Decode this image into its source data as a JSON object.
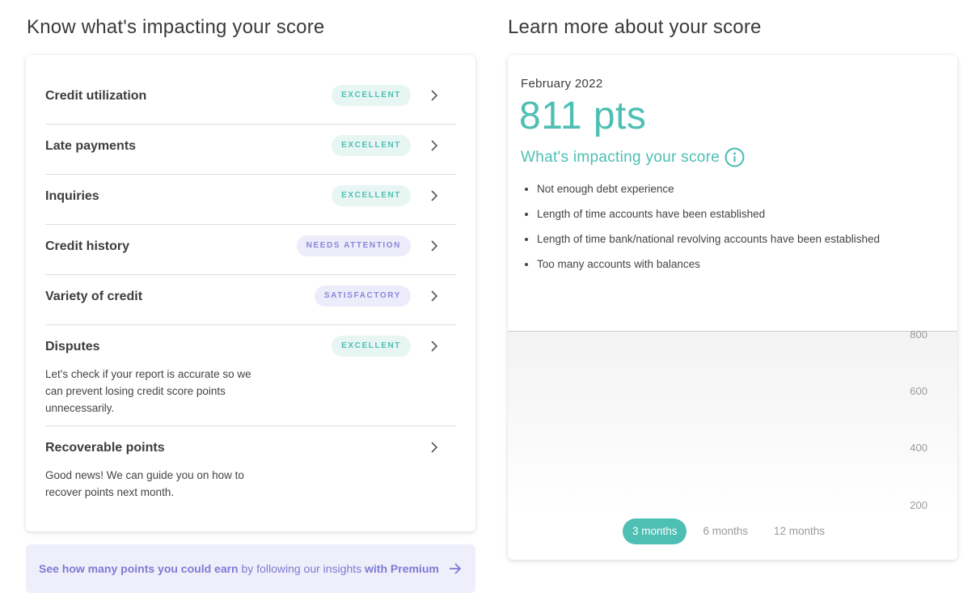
{
  "left": {
    "title": "Know what's impacting your score",
    "factors": [
      {
        "name": "Credit utilization",
        "status": "EXCELLENT",
        "status_kind": "excellent"
      },
      {
        "name": "Late payments",
        "status": "EXCELLENT",
        "status_kind": "excellent"
      },
      {
        "name": "Inquiries",
        "status": "EXCELLENT",
        "status_kind": "excellent"
      },
      {
        "name": "Credit history",
        "status": "NEEDS ATTENTION",
        "status_kind": "attention"
      },
      {
        "name": "Variety of credit",
        "status": "SATISFACTORY",
        "status_kind": "satisfactory"
      },
      {
        "name": "Disputes",
        "status": "EXCELLENT",
        "status_kind": "excellent",
        "description": "Let's check if your report is accurate so we can prevent losing credit score points unnecessarily."
      },
      {
        "name": "Recoverable points",
        "description": "Good news! We can guide you on how to recover points next month."
      }
    ],
    "premium_banner": {
      "bold_start": "See how many points you could earn",
      "middle": " by following our insights ",
      "bold_end": "with Premium"
    }
  },
  "right": {
    "title": "Learn more about your score",
    "date": "February 2022",
    "score": "811 pts",
    "impact_title": "What's impacting your score",
    "impact_items": [
      "Not enough debt experience",
      "Length of time accounts have been established",
      "Length of time bank/national revolving accounts have been established",
      "Too many accounts with balances"
    ],
    "range_tabs": [
      {
        "label": "3 months",
        "active": true
      },
      {
        "label": "6 months",
        "active": false
      },
      {
        "label": "12 months",
        "active": false
      }
    ]
  },
  "chart_data": {
    "type": "line",
    "title": "",
    "xlabel": "",
    "ylabel": "",
    "yticks": [
      "800",
      "600",
      "400",
      "200"
    ],
    "ylim": [
      200,
      800
    ],
    "series": []
  },
  "colors": {
    "accent": "#4dbfb3",
    "premium": "#7d7ad3",
    "excellent_bg": "#e8f6f3",
    "attention_bg": "#ececfb"
  }
}
